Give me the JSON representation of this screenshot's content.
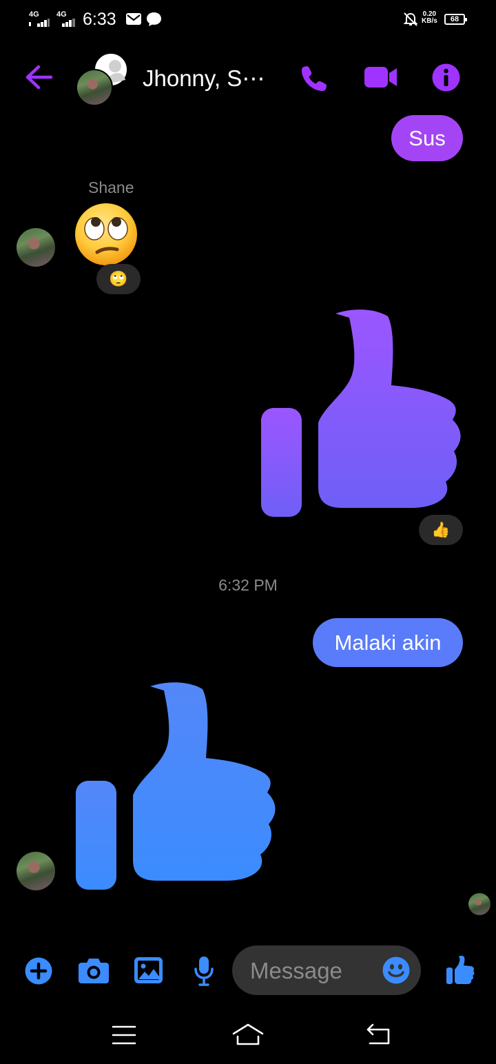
{
  "status_bar": {
    "network_1": "4G",
    "network_2": "4G",
    "time": "6:33",
    "speed_value": "0.20",
    "speed_unit": "KB/s",
    "battery": "68"
  },
  "header": {
    "title": "Jhonny, S⋯"
  },
  "messages": [
    {
      "type": "text",
      "direction": "outgoing",
      "text": "Sus"
    },
    {
      "type": "emoji",
      "direction": "incoming",
      "sender": "Shane",
      "reaction": "🙄"
    },
    {
      "type": "like",
      "direction": "outgoing",
      "reaction": "👍"
    },
    {
      "type": "timestamp",
      "text": "6:32 PM"
    },
    {
      "type": "text",
      "direction": "outgoing",
      "text": "Malaki akin"
    },
    {
      "type": "like",
      "direction": "incoming"
    }
  ],
  "composer": {
    "placeholder": "Message"
  },
  "colors": {
    "accent_purple": "#a033ff",
    "accent_blue": "#3b8cff",
    "bubble_sus": "#a445f5",
    "bubble_malaki": "#5a7cfa"
  },
  "icons": [
    "back-arrow-icon",
    "phone-icon",
    "video-camera-icon",
    "info-icon",
    "plus-icon",
    "camera-icon",
    "gallery-icon",
    "microphone-icon",
    "emoji-icon",
    "like-icon",
    "menu-icon",
    "home-icon",
    "return-icon"
  ]
}
